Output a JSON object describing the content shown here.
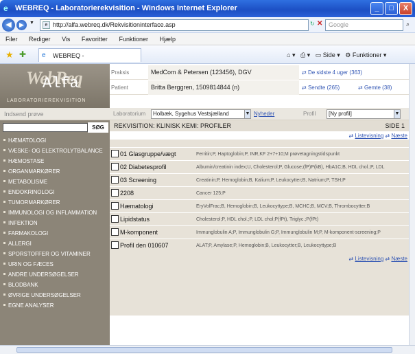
{
  "window": {
    "title": "WEBREQ - Laboratorierekvisition - Windows Internet Explorer",
    "minimize": "_",
    "maximize": "□",
    "close": "X"
  },
  "addressbar": {
    "url": "http://alfa.webreq.dk/Rekvisitioninterface.asp",
    "search_placeholder": "Google"
  },
  "menu": [
    "Filer",
    "Rediger",
    "Vis",
    "Favoritter",
    "Funktioner",
    "Hjælp"
  ],
  "tab": {
    "label": "WEBREQ - Laboratorierekvisition"
  },
  "toolbar": {
    "side": "Side",
    "funktioner": "Funktioner"
  },
  "logo": {
    "main": "WebReq",
    "alfa": "Alfa",
    "subtitle": "LABORATORIEREKVISITION"
  },
  "praksis": {
    "label": "Praksis",
    "value": "MedCom & Petersen (123456), DGV",
    "link": "De sidste 4 uger (363)"
  },
  "patient": {
    "label": "Patient",
    "value": "Britta Berggren, 1509814844 (n)",
    "link1": "Sendte (265)",
    "link2": "Gemte (38)"
  },
  "filters": {
    "indsend": "Indsend prøve",
    "laboratorium_label": "Laboratorium",
    "laboratorium_value": "Holbæk, Sygehus Vestsjælland",
    "nyheder": "Nyheder",
    "profil_label": "Profil",
    "profil_value": "[Ny profil]"
  },
  "sidebar": {
    "search_button": "SØG",
    "items": [
      "HÆMATOLOGI",
      "VÆSKE- OG ELEKTROLYTBALANCE",
      "HÆMOSTASE",
      "ORGANMARKØRER",
      "METABOLISME",
      "ENDOKRINOLOGI",
      "TUMORMARKØRER",
      "IMMUNOLOGI OG INFLAMMATION",
      "INFEKTION",
      "FARMAKOLOGI",
      "ALLERGI",
      "SPORSTOFFER OG VITAMINER",
      "URIN OG FÆCES",
      "ANDRE UNDERSØGELSER",
      "BLODBANK",
      "ØVRIGE UNDERSØGELSER",
      "EGNE ANALYSER"
    ]
  },
  "main": {
    "header": "REKVISITION: KLINISK KEMI: PROFILER",
    "page": "SIDE 1",
    "listevisning": "Listevisning",
    "naeste": "Næste"
  },
  "profiles": [
    {
      "name": "01 Glasgruppe/vægt",
      "desc": "Ferritin;P, Haptoglobin;P, INR,KF 2+7+10;M prøvetagningstidspunkt"
    },
    {
      "name": "02 Diabetesprofil",
      "desc": "Albumin/creatinin index;U, Cholesterol;P, Glucose;(fP)P(kB), HbA1C;B, HDL chol.;P, LDL"
    },
    {
      "name": "03 Screening",
      "desc": "Creatinin;P, Hemoglobin;B, Kalium;P, Leukocytter;B, Natrium;P, TSH;P"
    },
    {
      "name": "2208",
      "desc": "Cancer 125;P"
    },
    {
      "name": "Hæmatologi",
      "desc": "EryVolFrac;B, Hemoglobin;B, Leukocyttype;B, MCHC;B, MCV;B, Thrombocytter;B"
    },
    {
      "name": "Lipidstatus",
      "desc": "Cholesterol;P, HDL chol.;P, LDL chol;P(fPt), Triglyc.;P(fPt)"
    },
    {
      "name": "M-komponent",
      "desc": "Immunglobulin A;P, Immunglobulin G;P, Immunglobulin M;P, M-komponent-screening;P"
    },
    {
      "name": "Profil den 010607",
      "desc": "ALAT;P, Amylase;P, Hemoglobin;B, Leukocytter;B, Leukocyttype;B"
    }
  ]
}
